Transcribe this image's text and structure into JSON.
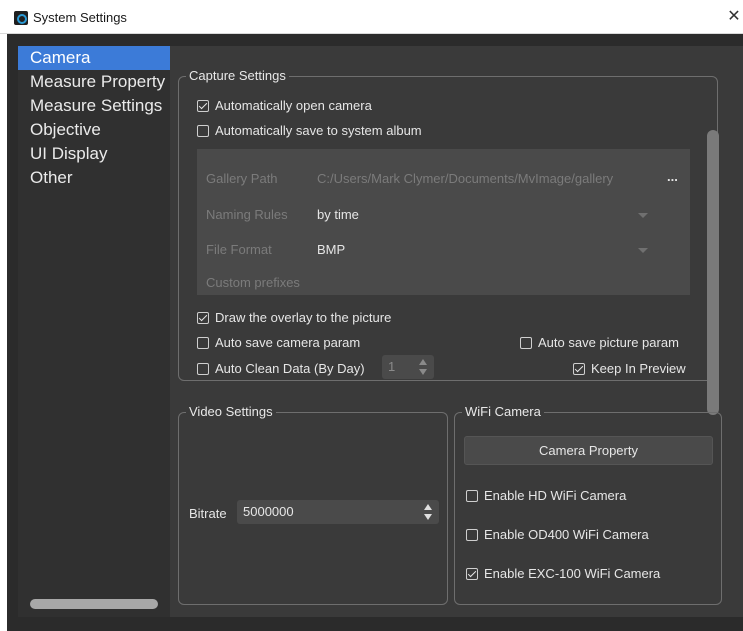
{
  "window": {
    "title": "System Settings",
    "close_glyph": "✕"
  },
  "sidebar": {
    "items": [
      {
        "label": "Camera",
        "active": true
      },
      {
        "label": "Measure Property",
        "active": false
      },
      {
        "label": "Measure Settings",
        "active": false
      },
      {
        "label": "Objective",
        "active": false
      },
      {
        "label": "UI Display",
        "active": false
      },
      {
        "label": "Other",
        "active": false
      }
    ]
  },
  "capture": {
    "title": "Capture Settings",
    "auto_open_camera": {
      "label": "Automatically open camera",
      "checked": true
    },
    "auto_save_album": {
      "label": "Automatically save to system album",
      "checked": false
    },
    "gallery_path": {
      "label": "Gallery Path",
      "value": "C:/Users/Mark Clymer/Documents/MvImage/gallery",
      "button": "..."
    },
    "naming_rules": {
      "label": "Naming Rules",
      "value": "by time"
    },
    "file_format": {
      "label": "File Format",
      "value": "BMP"
    },
    "custom_prefixes": {
      "label": "Custom prefixes",
      "value": ""
    },
    "draw_overlay": {
      "label": "Draw the overlay to the picture",
      "checked": true
    },
    "auto_save_camera_param": {
      "label": "Auto save camera param",
      "checked": false
    },
    "auto_save_picture_param": {
      "label": "Auto save picture param",
      "checked": false
    },
    "auto_clean": {
      "label": "Auto Clean Data (By Day)",
      "checked": false,
      "value": "1"
    },
    "keep_in_preview": {
      "label": "Keep In Preview",
      "checked": true
    }
  },
  "video": {
    "title": "Video Settings",
    "bitrate_label": "Bitrate",
    "bitrate_value": "5000000"
  },
  "wifi": {
    "title": "WiFi Camera",
    "camera_property_button": "Camera Property",
    "enable_hd": {
      "label": "Enable HD WiFi Camera",
      "checked": false
    },
    "enable_od400": {
      "label": "Enable OD400 WiFi Camera",
      "checked": false
    },
    "enable_exc100": {
      "label": "Enable EXC-100 WiFi Camera",
      "checked": true
    }
  },
  "colors": {
    "accent": "#3c7bd8",
    "background": "#3a3a3a",
    "sidebar": "#303030",
    "disabled_text": "#7b7b7b"
  }
}
